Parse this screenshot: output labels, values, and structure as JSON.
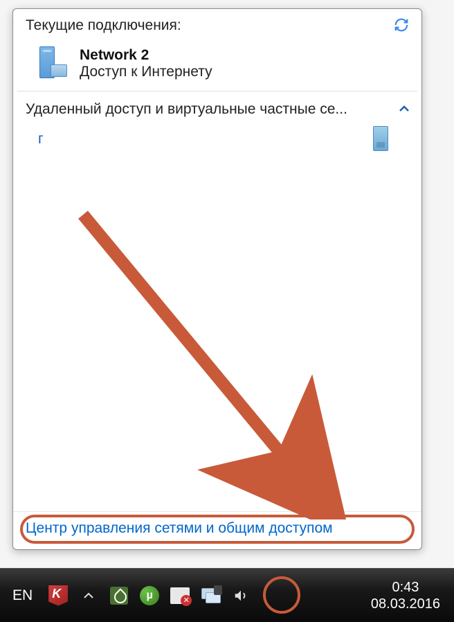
{
  "flyout": {
    "title": "Текущие подключения:",
    "refresh_icon": "refresh",
    "network": {
      "name": "Network  2",
      "status": "Доступ к Интернету"
    },
    "section_label": "Удаленный доступ и виртуальные частные се...",
    "vpn_item": "г",
    "footer_link": "Центр управления сетями и общим доступом"
  },
  "taskbar": {
    "language": "EN",
    "utorrent_glyph": "µ",
    "time": "0:43",
    "date": "08.03.2016"
  }
}
